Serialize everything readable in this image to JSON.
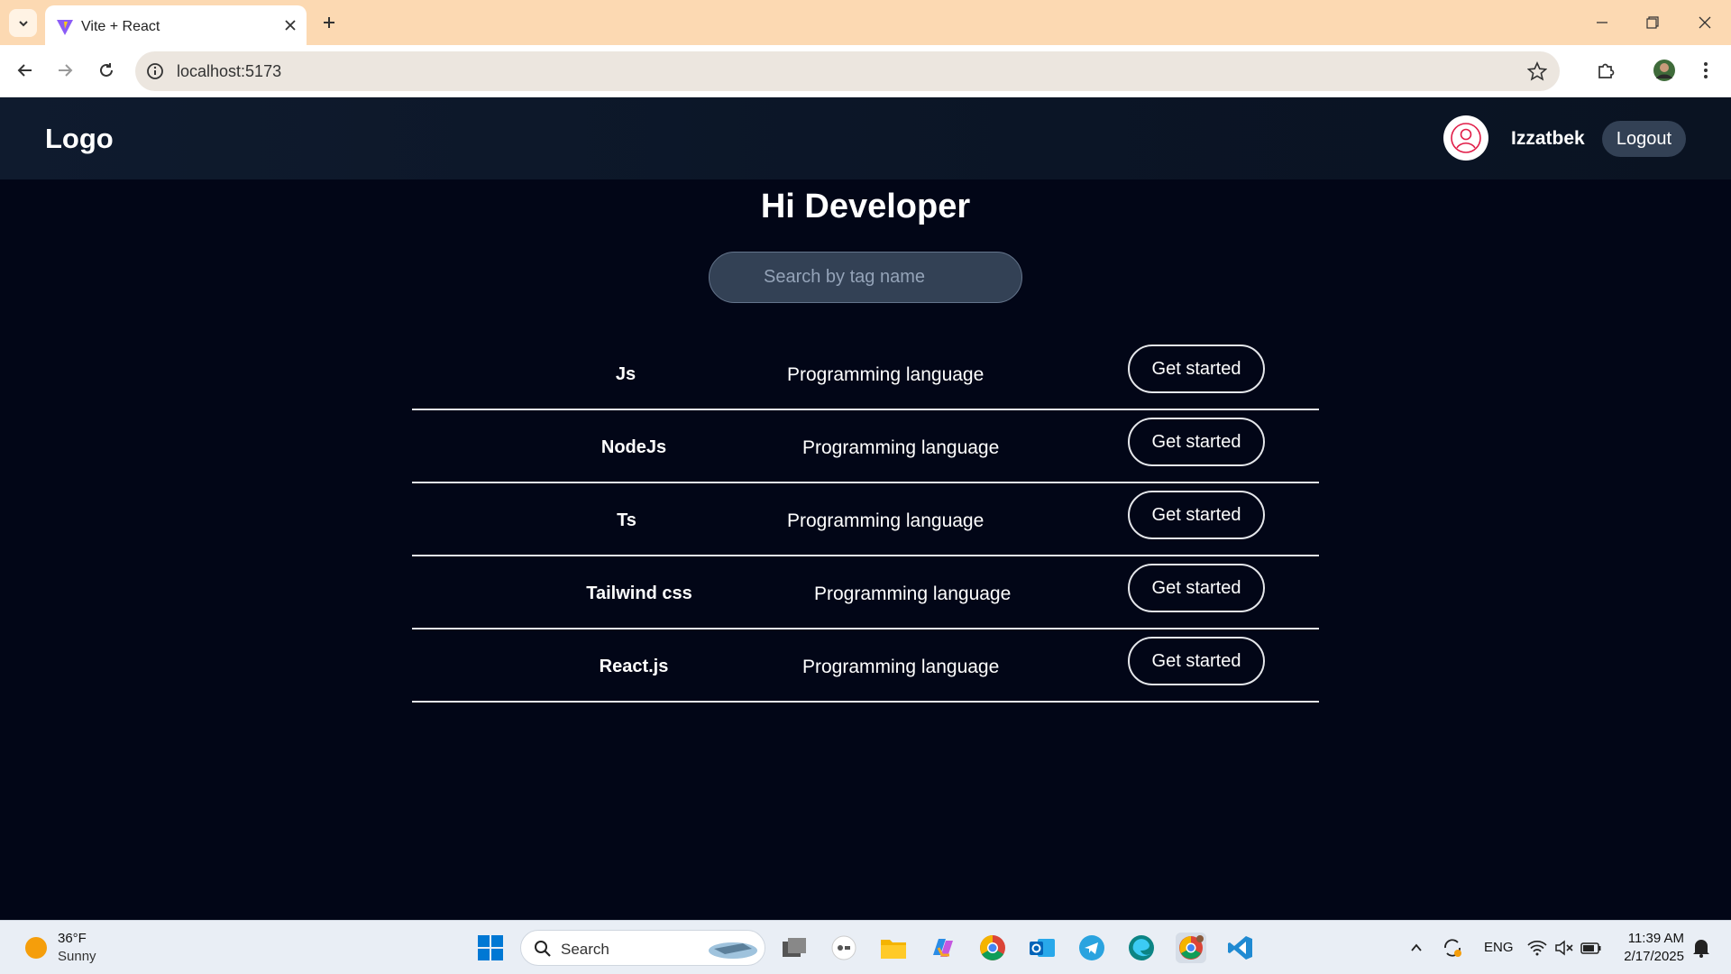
{
  "browser": {
    "tab_title": "Vite + React",
    "url": "localhost:5173"
  },
  "app": {
    "logo": "Logo",
    "username": "Izzatbek",
    "logout_label": "Logout",
    "greeting": "Hi Developer",
    "search_placeholder": "Search by tag name",
    "items": [
      {
        "name": "Js",
        "description": "Programming language",
        "action": "Get started"
      },
      {
        "name": "NodeJs",
        "description": "Programming language",
        "action": "Get started"
      },
      {
        "name": "Ts",
        "description": "Programming language",
        "action": "Get started"
      },
      {
        "name": "Tailwind css",
        "description": "Programming language",
        "action": "Get started"
      },
      {
        "name": "React.js",
        "description": "Programming language",
        "action": "Get started"
      }
    ]
  },
  "taskbar": {
    "weather_temp": "36°F",
    "weather_condition": "Sunny",
    "search_label": "Search",
    "language": "ENG",
    "time": "11:39 AM",
    "date": "2/17/2025"
  },
  "colors": {
    "app_background": "#020617",
    "header_background": "#0f1b2e",
    "tab_strip": "#fcd9b2",
    "logout_button": "#334155"
  }
}
